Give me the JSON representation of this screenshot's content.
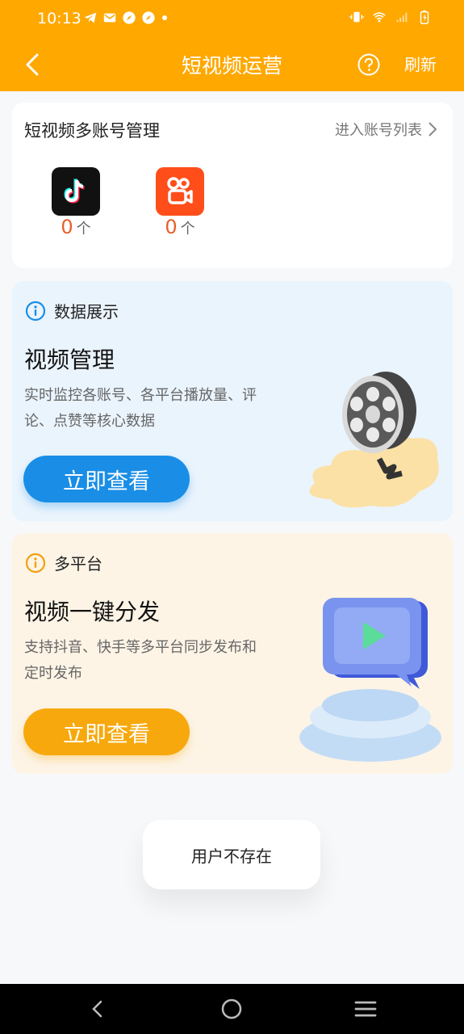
{
  "status_bar": {
    "time": "10:13"
  },
  "header": {
    "title": "短视频运营",
    "refresh_label": "刷新"
  },
  "accounts": {
    "title": "短视频多账号管理",
    "link_label": "进入账号列表",
    "platforms": [
      {
        "icon": "douyin-icon",
        "count": "0",
        "unit": "个"
      },
      {
        "icon": "kuaishou-icon",
        "count": "0",
        "unit": "个"
      }
    ]
  },
  "data_card": {
    "section_label": "数据展示",
    "title": "视频管理",
    "description": "实时监控各账号、各平台播放量、评论、点赞等核心数据",
    "button_label": "立即查看",
    "accent": "#1a8ee6"
  },
  "multi_card": {
    "section_label": "多平台",
    "title": "视频一键分发",
    "description": "支持抖音、快手等多平台同步发布和定时发布",
    "button_label": "立即查看",
    "accent": "#f7a80c"
  },
  "toast": {
    "message": "用户不存在"
  },
  "colors": {
    "brand": "#ffa800",
    "count": "#e85f2a"
  }
}
